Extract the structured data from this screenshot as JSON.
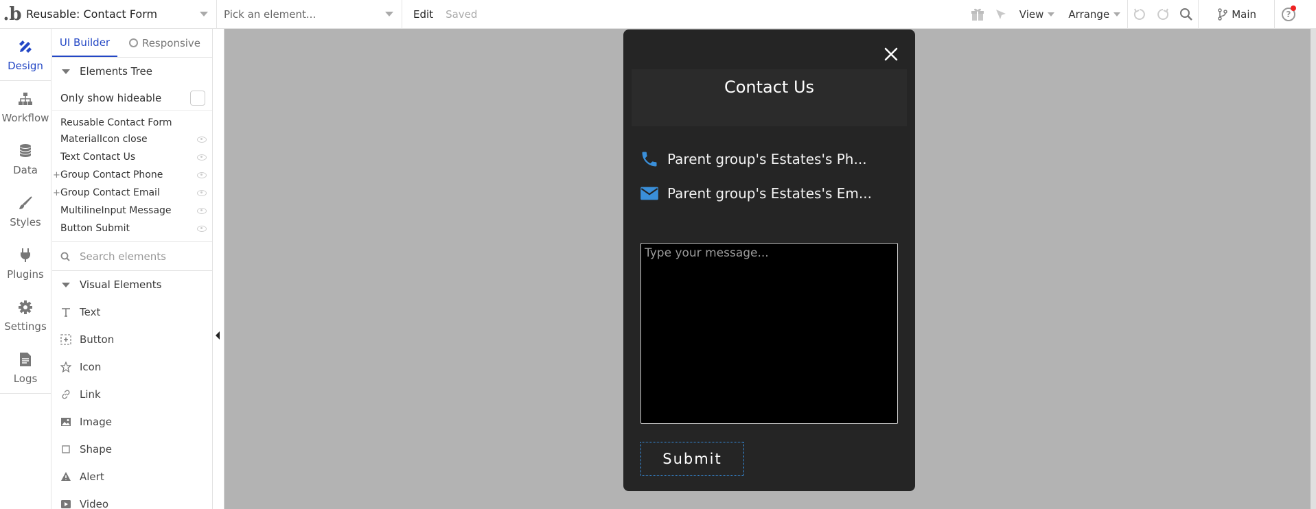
{
  "topbar": {
    "logo": ".b",
    "page_select": "Reusable: Contact Form",
    "element_select_placeholder": "Pick an element...",
    "edit": "Edit",
    "saved": "Saved",
    "view": "View",
    "arrange": "Arrange",
    "branch": "Main"
  },
  "leftnav": [
    {
      "label": "Design",
      "icon": "pencil-ruler-icon"
    },
    {
      "label": "Workflow",
      "icon": "sitemap-icon"
    },
    {
      "label": "Data",
      "icon": "database-icon"
    },
    {
      "label": "Styles",
      "icon": "brush-icon"
    },
    {
      "label": "Plugins",
      "icon": "plug-icon"
    },
    {
      "label": "Settings",
      "icon": "gear-icon"
    },
    {
      "label": "Logs",
      "icon": "document-icon"
    }
  ],
  "panel": {
    "tab_ui_builder": "UI Builder",
    "tab_responsive": "Responsive",
    "elements_tree": "Elements Tree",
    "only_show_hideable": "Only show hideable",
    "tree_root": "Reusable Contact Form",
    "tree_items": [
      {
        "label": "MaterialIcon close",
        "expandable": false
      },
      {
        "label": "Text Contact Us",
        "expandable": false
      },
      {
        "label": "Group Contact Phone",
        "expandable": true
      },
      {
        "label": "Group Contact Email",
        "expandable": true
      },
      {
        "label": "MultilineInput Message",
        "expandable": false
      },
      {
        "label": "Button Submit",
        "expandable": false
      }
    ],
    "search_placeholder": "Search elements",
    "visual_elements": "Visual Elements",
    "visual_items": [
      {
        "label": "Text",
        "icon": "text-icon"
      },
      {
        "label": "Button",
        "icon": "button-icon"
      },
      {
        "label": "Icon",
        "icon": "star-icon"
      },
      {
        "label": "Link",
        "icon": "link-icon"
      },
      {
        "label": "Image",
        "icon": "image-icon"
      },
      {
        "label": "Shape",
        "icon": "square-icon"
      },
      {
        "label": "Alert",
        "icon": "warning-icon"
      },
      {
        "label": "Video",
        "icon": "play-icon"
      }
    ]
  },
  "popup": {
    "title": "Contact Us",
    "phone": "Parent group's Estates's Ph...",
    "email": "Parent group's Estates's Em...",
    "message_placeholder": "Type your message...",
    "submit": "Submit",
    "accent_color": "#3a8fd9",
    "background_color": "#252525"
  }
}
